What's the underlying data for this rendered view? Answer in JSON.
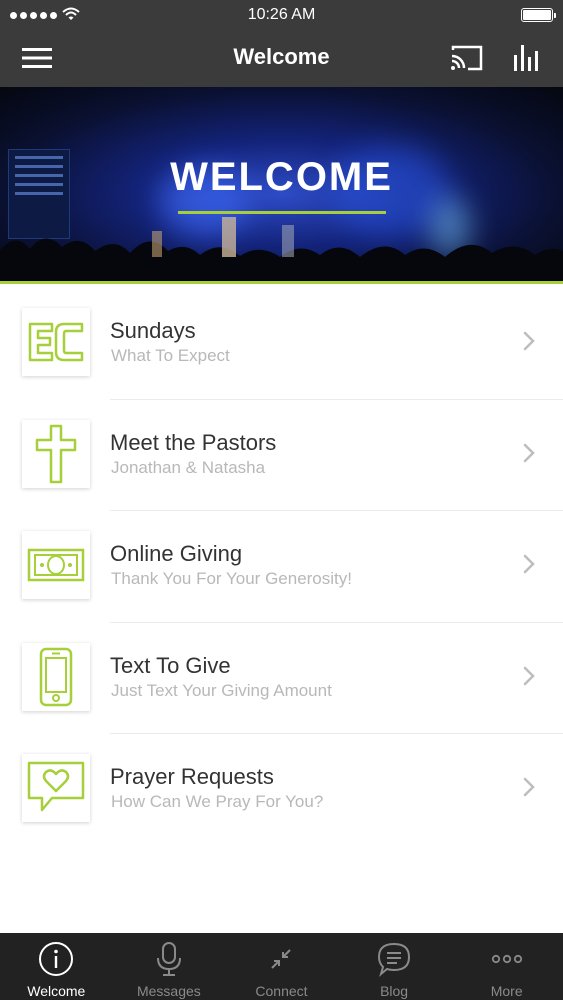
{
  "status_bar": {
    "time": "10:26 AM"
  },
  "nav": {
    "title": "Welcome"
  },
  "hero": {
    "title": "WELCOME"
  },
  "items": [
    {
      "icon": "ec-logo-icon",
      "label": "Sundays",
      "sublabel": "What To Expect"
    },
    {
      "icon": "cross-icon",
      "label": "Meet the Pastors",
      "sublabel": "Jonathan & Natasha"
    },
    {
      "icon": "money-icon",
      "label": "Online Giving",
      "sublabel": "Thank You For Your Generosity!"
    },
    {
      "icon": "phone-icon",
      "label": "Text To Give",
      "sublabel": "Just Text Your Giving Amount"
    },
    {
      "icon": "heart-chat-icon",
      "label": "Prayer Requests",
      "sublabel": "How Can We Pray For You?"
    }
  ],
  "tabs": [
    {
      "icon": "info-icon",
      "label": "Welcome",
      "active": true
    },
    {
      "icon": "microphone-icon",
      "label": "Messages",
      "active": false
    },
    {
      "icon": "compress-arrows-icon",
      "label": "Connect",
      "active": false
    },
    {
      "icon": "chat-bubble-icon",
      "label": "Blog",
      "active": false
    },
    {
      "icon": "more-dots-icon",
      "label": "More",
      "active": false
    }
  ],
  "colors": {
    "accent": "#a6cf3a",
    "bar": "#3b3b3b",
    "tabbar": "#222222"
  }
}
